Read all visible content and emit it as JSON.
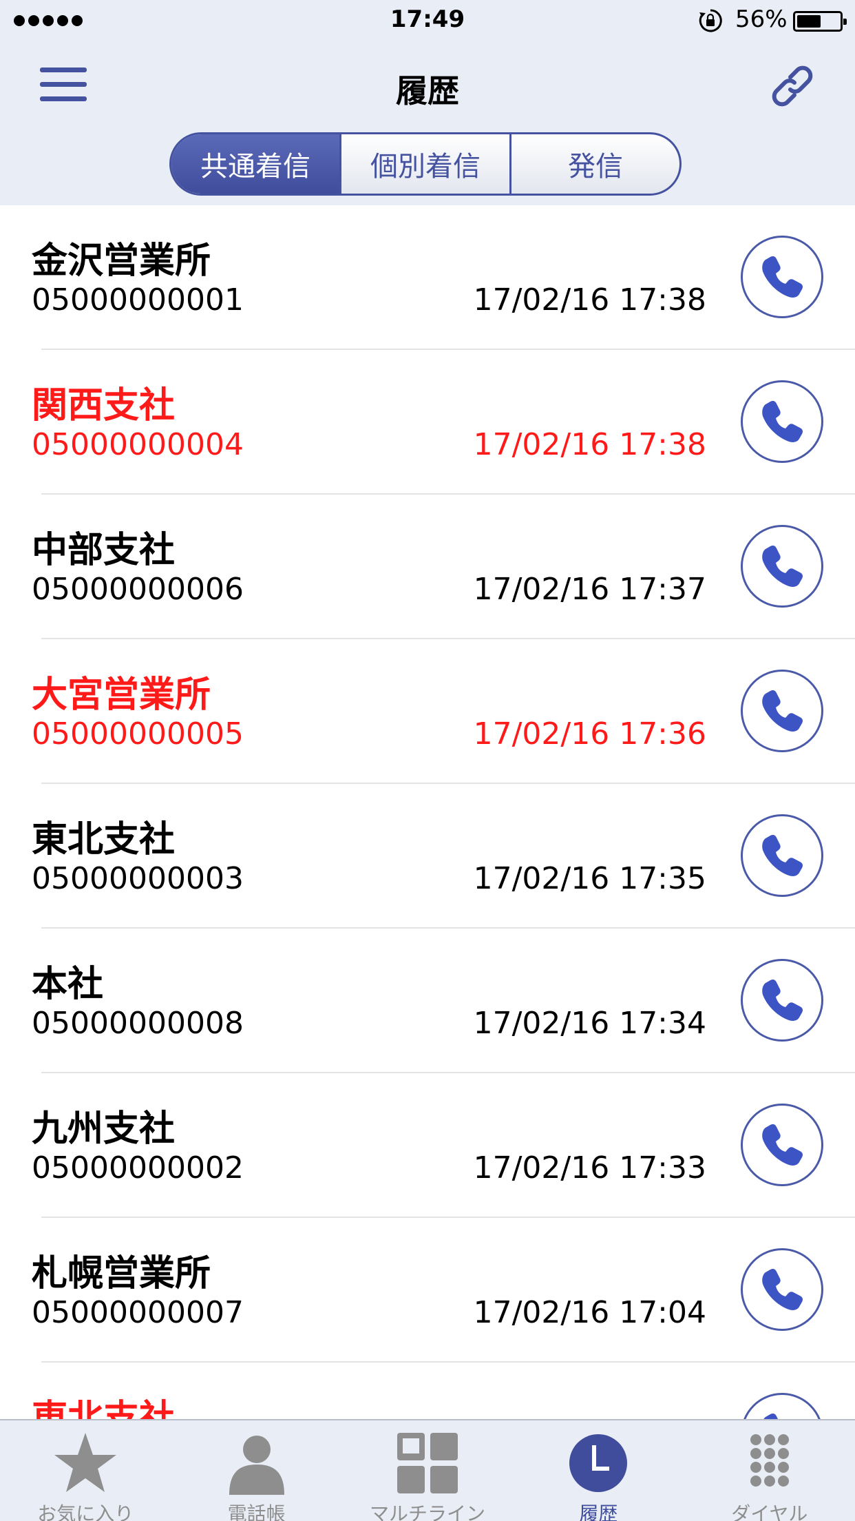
{
  "status_bar": {
    "time": "17:49",
    "battery_percent": "56%",
    "battery_level": 0.56,
    "signal_dots": 5
  },
  "header": {
    "title": "履歴",
    "menu_icon": "hamburger-menu-icon",
    "link_icon": "link-icon"
  },
  "segments": [
    {
      "label": "共通着信",
      "active": true
    },
    {
      "label": "個別着信",
      "active": false
    },
    {
      "label": "発信",
      "active": false
    }
  ],
  "history": [
    {
      "name": "金沢営業所",
      "number": "05000000001",
      "datetime": "17/02/16 17:38",
      "missed": false
    },
    {
      "name": "関西支社",
      "number": "05000000004",
      "datetime": "17/02/16 17:38",
      "missed": true
    },
    {
      "name": "中部支社",
      "number": "05000000006",
      "datetime": "17/02/16 17:37",
      "missed": false
    },
    {
      "name": "大宮営業所",
      "number": "05000000005",
      "datetime": "17/02/16 17:36",
      "missed": true
    },
    {
      "name": "東北支社",
      "number": "05000000003",
      "datetime": "17/02/16 17:35",
      "missed": false
    },
    {
      "name": "本社",
      "number": "05000000008",
      "datetime": "17/02/16 17:34",
      "missed": false
    },
    {
      "name": "九州支社",
      "number": "05000000002",
      "datetime": "17/02/16 17:33",
      "missed": false
    },
    {
      "name": "札幌営業所",
      "number": "05000000007",
      "datetime": "17/02/16 17:04",
      "missed": false
    },
    {
      "name": "東北支社",
      "number": "",
      "datetime": "",
      "missed": true
    }
  ],
  "tabbar": [
    {
      "label": "お気に入り",
      "icon": "star-icon",
      "active": false
    },
    {
      "label": "電話帳",
      "icon": "person-icon",
      "active": false
    },
    {
      "label": "マルチライン",
      "icon": "grid-icon",
      "active": false
    },
    {
      "label": "履歴",
      "icon": "clock-icon",
      "active": true
    },
    {
      "label": "ダイヤル",
      "icon": "keypad-icon",
      "active": false
    }
  ],
  "colors": {
    "accent": "#4452a0",
    "missed": "#ff1a1a",
    "inactive_tab": "#8e8e8e",
    "bar_background": "#e9eef6"
  }
}
